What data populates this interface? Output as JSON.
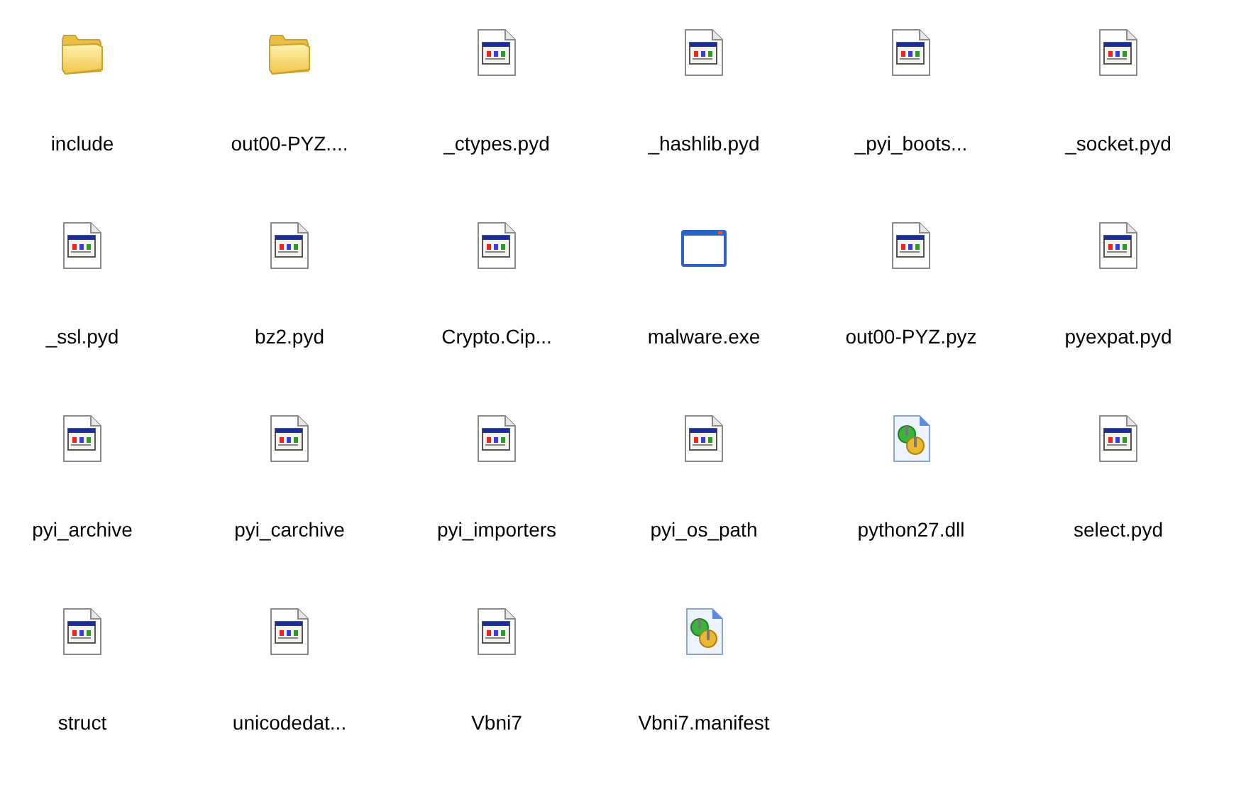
{
  "items": [
    {
      "name": "include",
      "kind": "folder"
    },
    {
      "name": "out00-PYZ....",
      "kind": "folder"
    },
    {
      "name": "_ctypes.pyd",
      "kind": "module"
    },
    {
      "name": "_hashlib.pyd",
      "kind": "module"
    },
    {
      "name": "_pyi_boots...",
      "kind": "module"
    },
    {
      "name": "_socket.pyd",
      "kind": "module"
    },
    {
      "name": "_ssl.pyd",
      "kind": "module"
    },
    {
      "name": "bz2.pyd",
      "kind": "module"
    },
    {
      "name": "Crypto.Cip...",
      "kind": "module"
    },
    {
      "name": "malware.exe",
      "kind": "application"
    },
    {
      "name": "out00-PYZ.pyz",
      "kind": "module"
    },
    {
      "name": "pyexpat.pyd",
      "kind": "module"
    },
    {
      "name": "pyi_archive",
      "kind": "module"
    },
    {
      "name": "pyi_carchive",
      "kind": "module"
    },
    {
      "name": "pyi_importers",
      "kind": "module"
    },
    {
      "name": "pyi_os_path",
      "kind": "module"
    },
    {
      "name": "python27.dll",
      "kind": "settings"
    },
    {
      "name": "select.pyd",
      "kind": "module"
    },
    {
      "name": "struct",
      "kind": "module"
    },
    {
      "name": "unicodedat...",
      "kind": "module"
    },
    {
      "name": "Vbni7",
      "kind": "module"
    },
    {
      "name": "Vbni7.manifest",
      "kind": "settings"
    }
  ]
}
